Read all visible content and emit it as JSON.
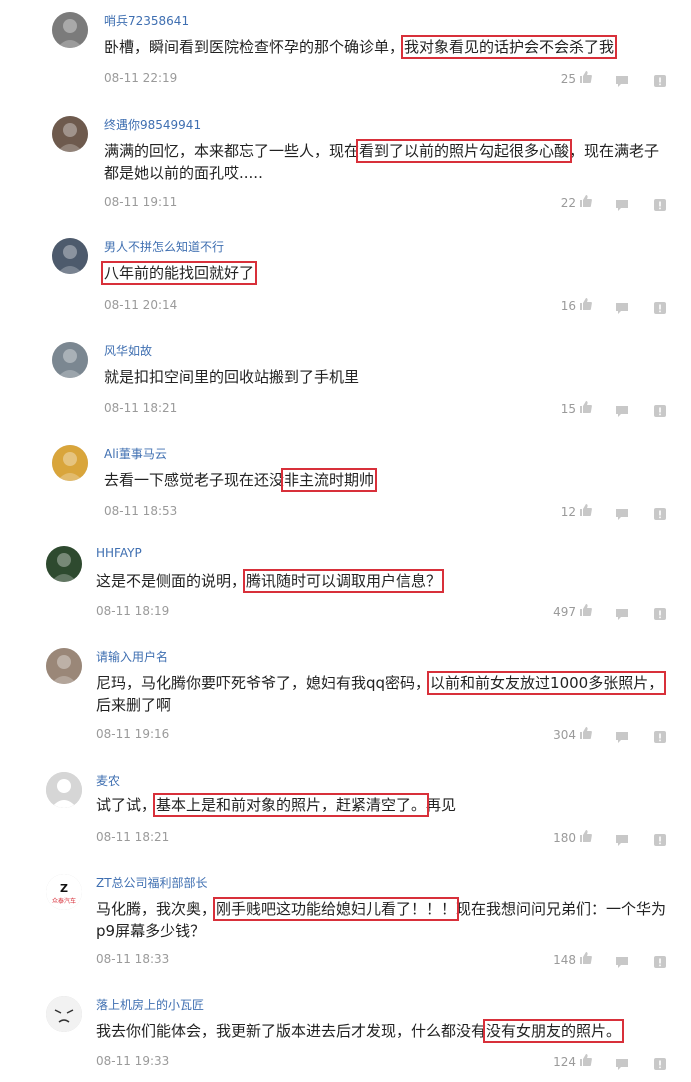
{
  "comments": [
    {
      "user": "哨兵72358641",
      "text_before": "卧槽，瞬间看到医院检查怀孕的那个确诊单，",
      "text_highlight": "我对象看见的话护会不会杀了我",
      "text_after": "",
      "time": "08-11 22:19",
      "likes": "25",
      "avatar_color": "#7b7b7b"
    },
    {
      "user": "终遇你98549941",
      "text_before": "满满的回忆，本来都忘了一些人，现在",
      "text_highlight": "看到了以前的照片勾起很多心酸",
      "text_after": "，现在满老子都是她以前的面孔哎.....",
      "time": "08-11 19:11",
      "likes": "22",
      "avatar_color": "#6e5a4d"
    },
    {
      "user": "男人不拼怎么知道不行",
      "text_before": "",
      "text_highlight": "八年前的能找回就好了",
      "text_after": "",
      "time": "08-11 20:14",
      "likes": "16",
      "avatar_color": "#4d5a6c"
    },
    {
      "user": "风华如故",
      "text_before": "就是扣扣空间里的回收站搬到了手机里",
      "text_highlight": "",
      "text_after": "",
      "time": "08-11 18:21",
      "likes": "15",
      "avatar_color": "#7b8791"
    },
    {
      "user": "Ali董事马云",
      "text_before": "去看一下感觉老子现在还没",
      "text_highlight": "非主流时期帅",
      "text_after": "",
      "time": "08-11 18:53",
      "likes": "12",
      "avatar_color": "#d9a53b"
    },
    {
      "user": "HHFAYP",
      "text_before": "这是不是侧面的说明，",
      "text_highlight": "腾讯随时可以调取用户信息？",
      "text_after": "",
      "time": "08-11 18:19",
      "likes": "497",
      "avatar_color": "#2e4a2f"
    },
    {
      "user": "请输入用户名",
      "text_before": "尼玛，马化腾你要吓死爷爷了，媳妇有我qq密码，",
      "text_highlight": "以前和前女友放过1000多张照片，",
      "text_after": "后来删了啊",
      "time": "08-11 19:16",
      "likes": "304",
      "avatar_color": "#9a8778"
    },
    {
      "user": "麦农",
      "text_before": "试了试，",
      "text_highlight": "基本上是和前对象的照片，赶紧清空了。",
      "text_after": "再见",
      "time": "08-11 18:21",
      "likes": "180",
      "avatar_color": "#c6c6c6"
    },
    {
      "user": "ZT总公司福利部部长",
      "text_before": "马化腾，我次奥，",
      "text_highlight": "刚手贱吧这功能给媳妇儿看了！！！",
      "text_after": "现在我想问问兄弟们：一个华为p9屏幕多少钱？",
      "time": "08-11 18:33",
      "likes": "148",
      "avatar_color": "#ffffff"
    },
    {
      "user": "落上机房上的小瓦匠",
      "text_before": "我去你们能体会，我更新了版本进去后才发现，什么都没有",
      "text_highlight": "没有女朋友的照片。",
      "text_after": "",
      "time": "08-11 19:33",
      "likes": "124",
      "avatar_color": "#ffffff"
    }
  ],
  "colors": {
    "username": "#3f6fb1",
    "highlight_border": "#d8303a",
    "meta": "#9a9a9a"
  },
  "icons": {
    "like": "thumbs-up-icon",
    "reply": "speech-bubble-icon",
    "report": "exclamation-icon"
  }
}
